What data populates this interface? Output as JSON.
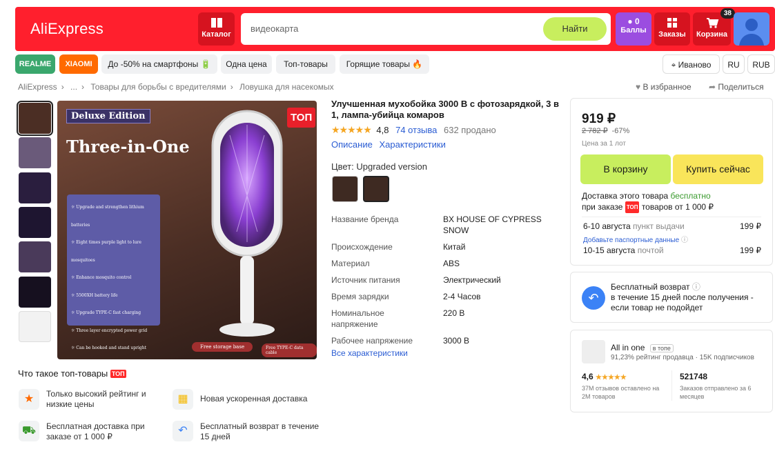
{
  "header": {
    "logo": "AliExpress",
    "catalog_label": "Каталог",
    "search_value": "видеокарта",
    "search_button": "Найти",
    "points_count": "0",
    "points_label": "Баллы",
    "orders_label": "Заказы",
    "cart_label": "Корзина",
    "cart_count": "38"
  },
  "chips": {
    "realme": "REALME",
    "xiaomi": "XIAOMI",
    "smartphones": "До -50% на смартфоны 🔋",
    "one_price": "Одна цена",
    "top": "Топ-товары",
    "hot": "Горящие товары 🔥",
    "city": "Иваново",
    "lang": "RU",
    "currency": "RUB"
  },
  "breadcrumb": {
    "items": [
      "AliExpress",
      "...",
      "Товары для борьбы с вредителями",
      "Ловушка для насекомых"
    ],
    "favorite": "В избранное",
    "share": "Поделиться"
  },
  "product": {
    "image_top_badge": "ТОП",
    "image_edition": "Deluxe Edition",
    "image_headline": "Three-in-One",
    "image_features": [
      "Upgrade and strengthen lithium batteries",
      "Eight times purple light to lure mosquitoes",
      "Enhance mosquito control",
      "5500XH battery life",
      "Upgrade TYPE-C fast charging",
      "Three layer encrypted power grid",
      "Can be hooked and stand upright"
    ],
    "image_base_label": "Free storage base",
    "image_cable_label": "Free TYPE-C data cable",
    "title": "Улучшенная мухобойка 3000 В с фотозарядкой, 3 в 1, лампа-убийца комаров",
    "stars": "★★★★★",
    "rating": "4,8",
    "reviews": "74 отзыва",
    "sold": "632 продано",
    "tab_description": "Описание",
    "tab_specs": "Характеристики",
    "color_label": "Цвет: Upgraded version",
    "specs": [
      {
        "k": "Название бренда",
        "v": "BX HOUSE OF CYPRESS SNOW"
      },
      {
        "k": "Происхождение",
        "v": "Китай"
      },
      {
        "k": "Материал",
        "v": "ABS"
      },
      {
        "k": "Источник питания",
        "v": "Электрический"
      },
      {
        "k": "Время зарядки",
        "v": "2-4 Часов"
      },
      {
        "k": "Номинальное напряжение",
        "v": "220 В"
      },
      {
        "k": "Рабочее напряжение",
        "v": "3000 В"
      }
    ],
    "all_specs": "Все характеристики"
  },
  "buybox": {
    "price": "919 ₽",
    "old_price": "2 782 ₽",
    "discount": "-67%",
    "per_lot": "Цена за 1 лот",
    "cart_button": "В корзину",
    "buy_button": "Купить сейчас",
    "ship_line1_a": "Доставка этого товара ",
    "ship_line1_b": "бесплатно",
    "ship_line2_a": "при заказе ",
    "ship_top_tag": "ТОП",
    "ship_line2_b": " товаров от 1 000 ₽",
    "d1_date": "6-10 августа",
    "d1_type": "пункт выдачи",
    "d1_price": "199 ₽",
    "d1_note": "Добавьте паспортные данные",
    "d2_date": "10-15 августа",
    "d2_type": "почтой",
    "d2_price": "199 ₽"
  },
  "returns": {
    "title": "Бесплатный возврат",
    "text": "в течение 15 дней после получения - если товар не подойдет"
  },
  "store": {
    "name": "All in one",
    "tag": "в топе",
    "rating_line": "91,23% рейтинг продавца · 15K подписчиков",
    "score": "4,6",
    "score_stars": "★★★★★",
    "score_note": "37M отзывов оставлено на 2M товаров",
    "orders": "521748",
    "orders_note": "Заказов отправлено за 6 месяцев"
  },
  "top_info": {
    "title": "Что такое топ-товары",
    "title_tag": "ТОП",
    "f1": "Только высокий рейтинг и низкие цены",
    "f2": "Новая ускоренная доставка",
    "f3": "Бесплатная доставка при заказе от 1 000 ₽",
    "f4": "Бесплатный возврат в течение 15 дней"
  }
}
